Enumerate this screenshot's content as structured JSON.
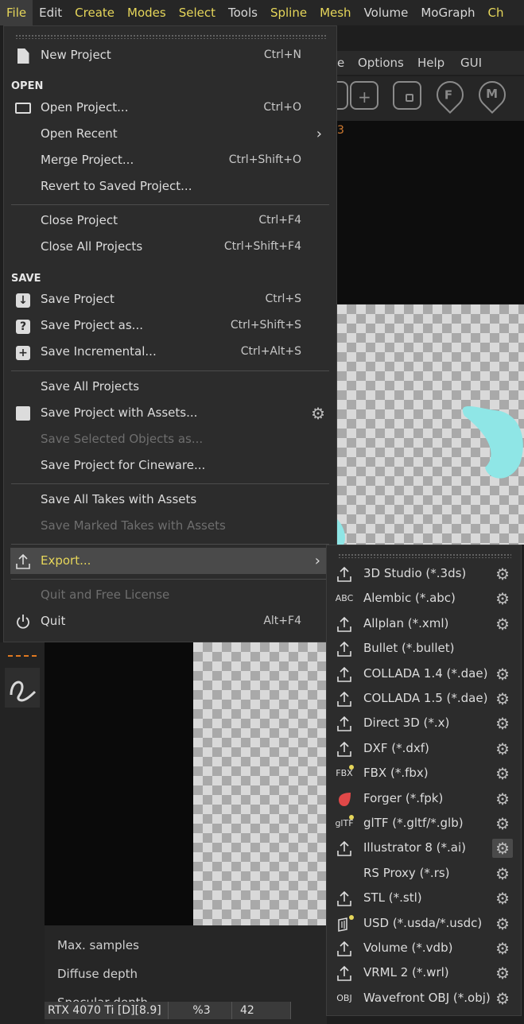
{
  "menubar": [
    {
      "label": "File",
      "highlight": true,
      "active": true
    },
    {
      "label": "Edit",
      "highlight": false
    },
    {
      "label": "Create",
      "highlight": true
    },
    {
      "label": "Modes",
      "highlight": true
    },
    {
      "label": "Select",
      "highlight": true
    },
    {
      "label": "Tools",
      "highlight": false
    },
    {
      "label": "Spline",
      "highlight": true
    },
    {
      "label": "Mesh",
      "highlight": true
    },
    {
      "label": "Volume",
      "highlight": false
    },
    {
      "label": "MoGraph",
      "highlight": false
    },
    {
      "label": "Ch",
      "highlight": true
    }
  ],
  "bg_toolbar": {
    "partial": "e",
    "options": "Options",
    "help": "Help",
    "gui": "GUI",
    "value": "3"
  },
  "bg_icons": {
    "f": "F",
    "m": "M"
  },
  "render_settings": {
    "max_samples": "Max. samples",
    "diffuse_depth": "Diffuse depth",
    "specular_depth": "Specular depth"
  },
  "statusbar": {
    "gpu": "RTX 4070 Ti [D][8.9]",
    "percent": "%3",
    "count": "42"
  },
  "file_menu": {
    "new_project": {
      "label": "New Project",
      "shortcut": "Ctrl+N"
    },
    "section_open": "OPEN",
    "open_project": {
      "label": "Open Project...",
      "shortcut": "Ctrl+O"
    },
    "open_recent": {
      "label": "Open Recent"
    },
    "merge_project": {
      "label": "Merge Project...",
      "shortcut": "Ctrl+Shift+O"
    },
    "revert": {
      "label": "Revert to Saved Project..."
    },
    "close_project": {
      "label": "Close Project",
      "shortcut": "Ctrl+F4"
    },
    "close_all": {
      "label": "Close All Projects",
      "shortcut": "Ctrl+Shift+F4"
    },
    "section_save": "SAVE",
    "save_project": {
      "label": "Save Project",
      "shortcut": "Ctrl+S"
    },
    "save_as": {
      "label": "Save Project as...",
      "shortcut": "Ctrl+Shift+S"
    },
    "save_incremental": {
      "label": "Save Incremental...",
      "shortcut": "Ctrl+Alt+S"
    },
    "save_all": {
      "label": "Save All Projects"
    },
    "save_with_assets": {
      "label": "Save Project with Assets..."
    },
    "save_selected": {
      "label": "Save Selected Objects as...",
      "disabled": true
    },
    "save_cineware": {
      "label": "Save Project for Cineware..."
    },
    "save_all_takes": {
      "label": "Save All Takes with Assets"
    },
    "save_marked_takes": {
      "label": "Save Marked Takes with Assets",
      "disabled": true
    },
    "export": {
      "label": "Export..."
    },
    "quit_free": {
      "label": "Quit and Free License",
      "disabled": true
    },
    "quit": {
      "label": "Quit",
      "shortcut": "Alt+F4"
    }
  },
  "export_menu": [
    {
      "label": "3D Studio (*.3ds)",
      "icon": "export-icon",
      "gear": true
    },
    {
      "label": "Alembic (*.abc)",
      "icon": "abc-icon",
      "icon_text": "ABC",
      "gear": true
    },
    {
      "label": "Allplan (*.xml)",
      "icon": "export-icon",
      "gear": true
    },
    {
      "label": "Bullet (*.bullet)",
      "icon": "export-icon",
      "gear": false
    },
    {
      "label": "COLLADA 1.4 (*.dae)",
      "icon": "export-icon",
      "gear": true
    },
    {
      "label": "COLLADA 1.5 (*.dae)",
      "icon": "export-icon",
      "gear": true
    },
    {
      "label": "Direct 3D (*.x)",
      "icon": "export-icon",
      "gear": true
    },
    {
      "label": "DXF (*.dxf)",
      "icon": "export-icon",
      "gear": true
    },
    {
      "label": "FBX (*.fbx)",
      "icon": "fbx-icon",
      "icon_text": "FBX",
      "gear": true
    },
    {
      "label": "Forger (*.fpk)",
      "icon": "forger-icon",
      "gear": true
    },
    {
      "label": "glTF (*.gltf/*.glb)",
      "icon": "gltf-icon",
      "icon_text": "glTF",
      "gear": true
    },
    {
      "label": "Illustrator 8 (*.ai)",
      "icon": "export-icon",
      "gear": true,
      "hover": true
    },
    {
      "label": "RS Proxy (*.rs)",
      "icon": "",
      "gear": true
    },
    {
      "label": "STL (*.stl)",
      "icon": "export-icon",
      "gear": true
    },
    {
      "label": "USD (*.usda/*.usdc)",
      "icon": "usd-icon",
      "gear": true
    },
    {
      "label": "Volume (*.vdb)",
      "icon": "export-icon",
      "gear": true
    },
    {
      "label": "VRML 2 (*.wrl)",
      "icon": "export-icon",
      "gear": true
    },
    {
      "label": "Wavefront OBJ (*.obj)",
      "icon": "obj-icon",
      "icon_text": "OBJ",
      "gear": true
    }
  ],
  "colors": {
    "accent": "#e6d65a",
    "menu_bg": "#2c2c2c",
    "forger": "#e04848",
    "canvas_shape": "#8fe6e6"
  }
}
